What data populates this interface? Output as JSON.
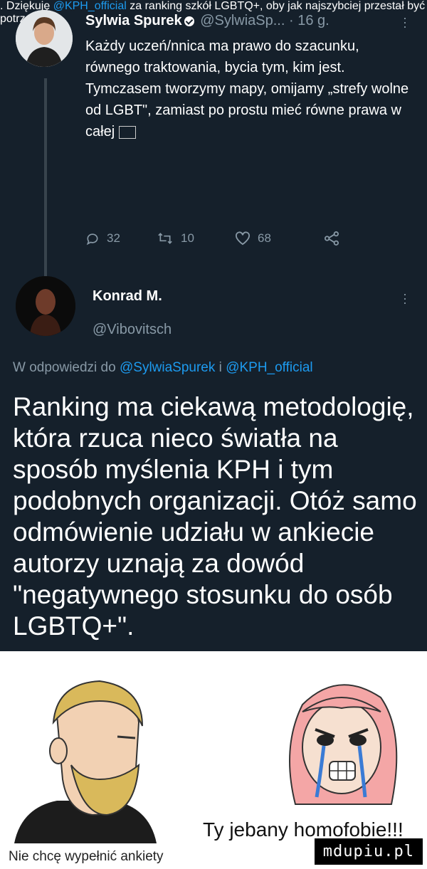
{
  "tweet": {
    "author_name": "Sylwia Spurek",
    "author_handle": "@SylwiaSp...",
    "time_sep": "·",
    "timestamp": "16 g.",
    "text_part1": "Każdy uczeń/nnica ma prawo do szacunku, równego traktowania, bycia tym, kim jest. Tymczasem tworzymy mapy, omijamy „strefy wolne od LGBT\", zamiast po prostu mieć równe prawa w całej",
    "text_part2": ". Dziękuję",
    "mention": "@KPH_official",
    "text_part3": " za ranking szkół LGBTQ+, oby jak najszybciej przestał być potrzebny!",
    "replies": "32",
    "retweets": "10",
    "likes": "68"
  },
  "reply": {
    "author_name": "Konrad M.",
    "author_handle": "@Vibovitsch",
    "replying_prefix": "W odpowiedzi do",
    "replying_to_1": "@SylwiaSpurek",
    "replying_and": "i",
    "replying_to_2": "@KPH_official",
    "text": "Ranking ma ciekawą metodologię, która rzuca nieco światła na sposób myślenia KPH i tym podobnych organizacji. Otóż samo odmówienie udziału w ankiecie autorzy uznają za dowód \"negatywnego stosunku do osób LGBTQ+\"."
  },
  "meme": {
    "left_caption": "Nie chcę wypełnić ankiety",
    "right_caption": "Ty jebany homofobie!!!"
  },
  "watermark": "mdupiu.pl",
  "icons": {
    "reply": "speech-bubble-icon",
    "retweet": "retweet-icon",
    "like": "heart-icon",
    "share": "share-icon",
    "more": "more-dots-icon"
  }
}
